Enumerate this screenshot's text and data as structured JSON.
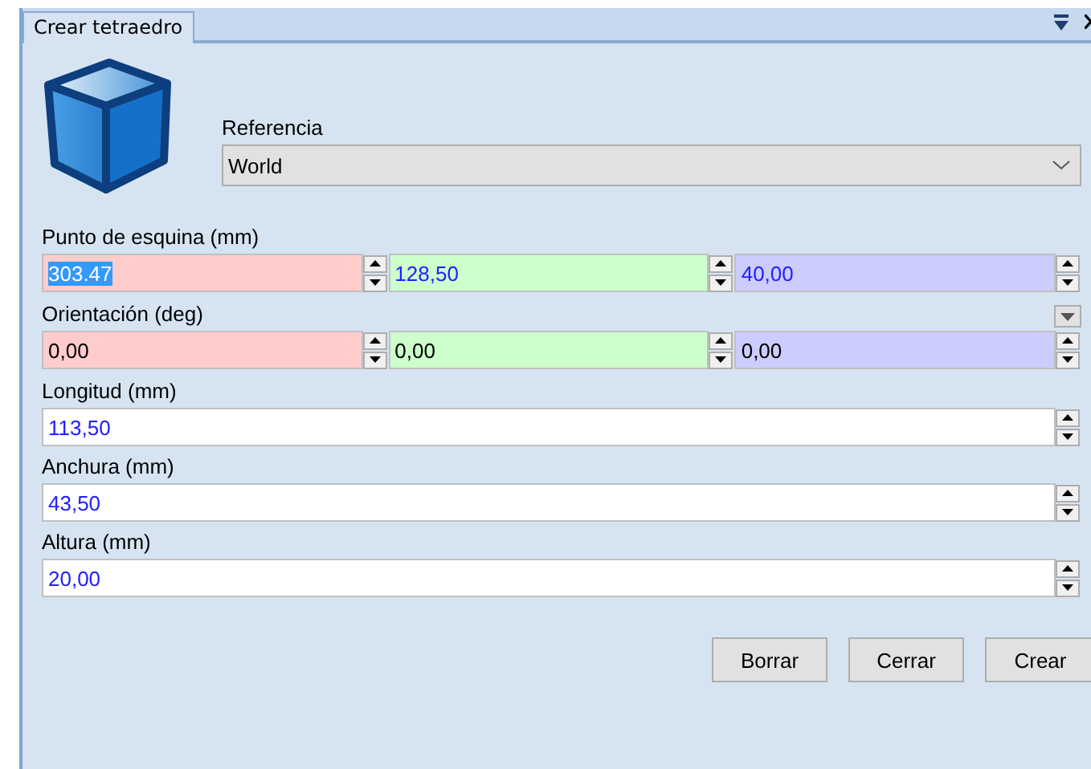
{
  "panel": {
    "tab": {
      "label": "Crear tetraedro",
      "selected": true
    }
  },
  "reference": {
    "label": "Referencia",
    "value": "World"
  },
  "vector_groups": [
    {
      "label": "Punto de esquina (mm)",
      "collapsible": false,
      "fields": [
        {
          "value": "303.47",
          "color": "#ffcccc",
          "edited": true,
          "text_selected": true
        },
        {
          "value": "128,50",
          "color": "#ccffcc",
          "edited": true,
          "text_selected": false
        },
        {
          "value": "40,00",
          "color": "#ccccff",
          "edited": true,
          "text_selected": false
        }
      ]
    },
    {
      "label": "Orientación (deg)",
      "collapsible": true,
      "fields": [
        {
          "value": "0,00",
          "color": "#ffcccc",
          "edited": false,
          "text_selected": false
        },
        {
          "value": "0,00",
          "color": "#ccffcc",
          "edited": false,
          "text_selected": false
        },
        {
          "value": "0,00",
          "color": "#ccccff",
          "edited": false,
          "text_selected": false
        }
      ]
    }
  ],
  "scalar_fields": [
    {
      "label": "Longitud (mm)",
      "value": "113,50",
      "edited": true
    },
    {
      "label": "Anchura (mm)",
      "value": "43,50",
      "edited": true
    },
    {
      "label": "Altura (mm)",
      "value": "20,00",
      "edited": true
    }
  ],
  "buttons": [
    "Borrar",
    "Cerrar",
    "Crear"
  ]
}
